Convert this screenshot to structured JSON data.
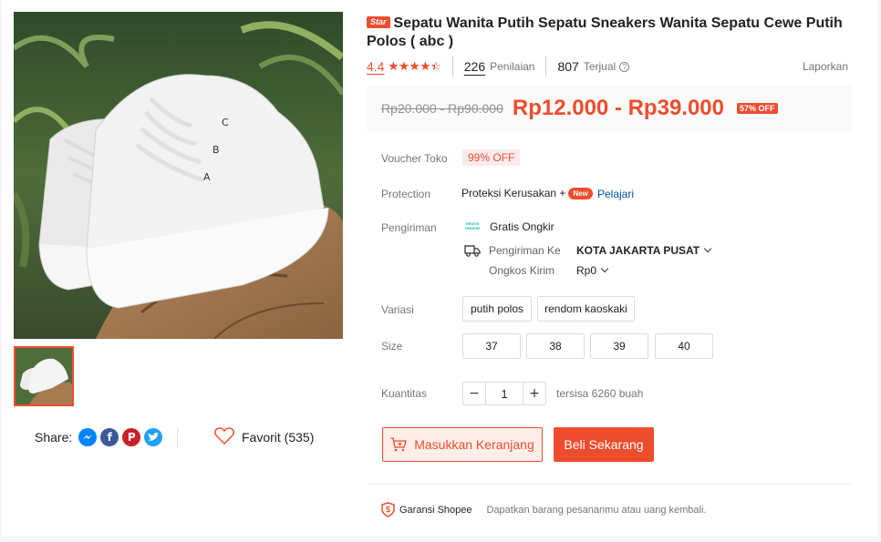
{
  "product": {
    "badge": "Star",
    "title": "Sepatu Wanita Putih Sepatu Sneakers Wanita Sepatu Cewe Putih Polos ( abc )"
  },
  "stats": {
    "rating": "4.4",
    "rating_value": 4.4,
    "stars_max": 5,
    "reviews_count": "226",
    "reviews_label": "Penilaian",
    "sold_count": "807",
    "sold_label": "Terjual",
    "report_label": "Laporkan"
  },
  "price": {
    "original": "Rp20.000 - Rp90.000",
    "current": "Rp12.000 - Rp39.000",
    "discount": "57% OFF"
  },
  "voucher": {
    "label": "Voucher Toko",
    "value": "99% OFF"
  },
  "protection": {
    "label": "Protection",
    "value": "Proteksi Kerusakan +",
    "new_badge": "New",
    "learn_more": "Pelajari"
  },
  "shipping": {
    "label": "Pengiriman",
    "free_logo_text": "GRATIS ONGKIR",
    "free_label": "Gratis Ongkir",
    "ship_to_label": "Pengiriman Ke",
    "ship_to_value": "KOTA JAKARTA PUSAT",
    "cost_label": "Ongkos Kirim",
    "cost_value": "Rp0"
  },
  "variation": {
    "label": "Variasi",
    "options": [
      "putih polos",
      "rendom kaoskaki"
    ]
  },
  "size": {
    "label": "Size",
    "options": [
      "37",
      "38",
      "39",
      "40"
    ]
  },
  "quantity": {
    "label": "Kuantitas",
    "minus": "−",
    "value": "1",
    "plus": "+",
    "stock": "tersisa 6260 buah"
  },
  "actions": {
    "add_to_cart": "Masukkan Keranjang",
    "buy_now": "Beli Sekarang"
  },
  "share": {
    "label": "Share:",
    "icons": [
      "messenger-icon",
      "facebook-icon",
      "pinterest-icon",
      "twitter-icon"
    ]
  },
  "favorite": {
    "label": "Favorit (535)"
  },
  "guarantee": {
    "title": "Garansi Shopee",
    "description": "Dapatkan barang pesananmu atau uang kembali."
  },
  "colors": {
    "accent": "#ee4d2d",
    "link": "#0055aa",
    "voucher_bg": "#fbebed"
  }
}
